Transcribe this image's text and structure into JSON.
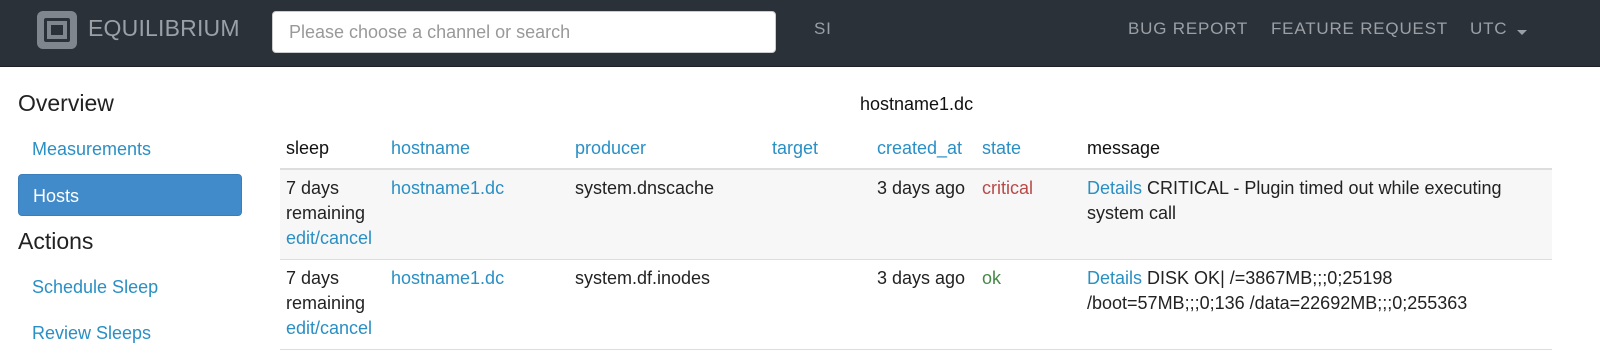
{
  "navbar": {
    "brand": "EQUILIBRIUM",
    "search_placeholder": "Please choose a channel or search",
    "si": "SI",
    "bug_report": "BUG REPORT",
    "feature_request": "FEATURE REQUEST",
    "timezone": "UTC"
  },
  "sidebar": {
    "overview_heading": "Overview",
    "overview_items": [
      "Measurements",
      "Hosts"
    ],
    "active_item": "Hosts",
    "actions_heading": "Actions",
    "action_items": [
      "Schedule Sleep",
      "Review Sleeps"
    ]
  },
  "table": {
    "title": "hostname1.dc",
    "columns": [
      "sleep",
      "hostname",
      "producer",
      "target",
      "created_at",
      "state",
      "message"
    ],
    "rows": [
      {
        "sleep_line1": "7 days",
        "sleep_line2": "remaining",
        "sleep_link": "edit/cancel",
        "hostname": "hostname1.dc",
        "producer": "system.dnscache",
        "target": "",
        "created_at": "3 days ago",
        "state": "critical",
        "details": "Details",
        "message_line1": "CRITICAL - Plugin timed out while executing",
        "message_line2": "system call"
      },
      {
        "sleep_line1": "7 days",
        "sleep_line2": "remaining",
        "sleep_link": "edit/cancel",
        "hostname": "hostname1.dc",
        "producer": "system.df.inodes",
        "target": "",
        "created_at": "3 days ago",
        "state": "ok",
        "details": "Details",
        "message_line1": "DISK OK| /=3867MB;;;0;25198",
        "message_line2": "/boot=57MB;;;0;136 /data=22692MB;;;0;255363"
      }
    ]
  },
  "colors": {
    "navbar_bg": "#2b3139",
    "link": "#2a8fc4",
    "active_bg": "#428bca",
    "critical": "#b94a48",
    "ok": "#468847"
  }
}
